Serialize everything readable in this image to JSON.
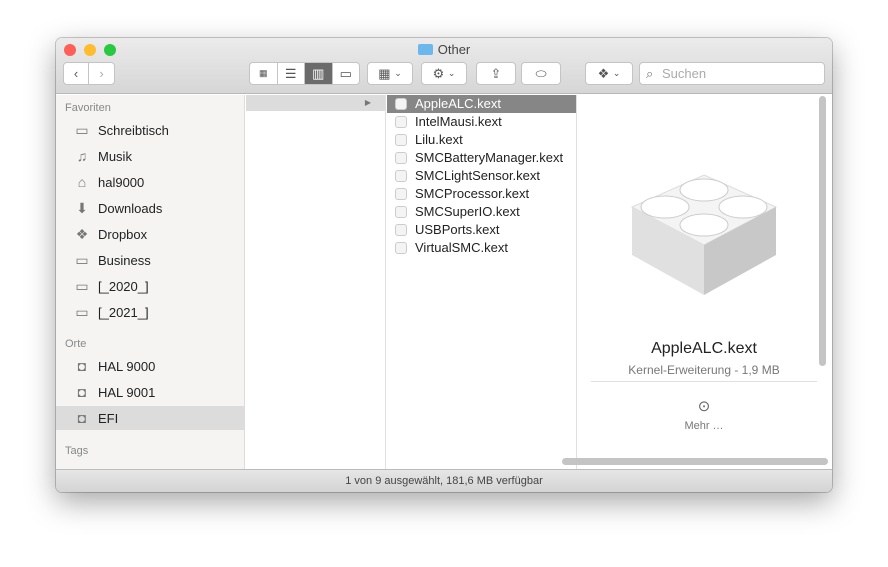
{
  "window": {
    "title": "Other"
  },
  "toolbar": {
    "search_placeholder": "Suchen"
  },
  "sidebar": {
    "favorites_header": "Favoriten",
    "favorites": [
      {
        "label": "Schreibtisch",
        "icon": "desktop-icon"
      },
      {
        "label": "Musik",
        "icon": "music-icon"
      },
      {
        "label": "hal9000",
        "icon": "home-icon"
      },
      {
        "label": "Downloads",
        "icon": "downloads-icon"
      },
      {
        "label": "Dropbox",
        "icon": "dropbox-icon"
      },
      {
        "label": "Business",
        "icon": "folder-icon"
      },
      {
        "label": "[_2020_]",
        "icon": "folder-icon"
      },
      {
        "label": "[_2021_]",
        "icon": "folder-icon"
      }
    ],
    "places_header": "Orte",
    "places": [
      {
        "label": "HAL 9000",
        "icon": "disk-icon"
      },
      {
        "label": "HAL 9001",
        "icon": "disk-icon"
      },
      {
        "label": "EFI",
        "icon": "disk-icon",
        "selected": true
      }
    ],
    "tags_header": "Tags"
  },
  "files": [
    "AppleALC.kext",
    "IntelMausi.kext",
    "Lilu.kext",
    "SMCBatteryManager.kext",
    "SMCLightSensor.kext",
    "SMCProcessor.kext",
    "SMCSuperIO.kext",
    "USBPorts.kext",
    "VirtualSMC.kext"
  ],
  "preview": {
    "name": "AppleALC.kext",
    "info": "Kernel-Erweiterung - 1,9 MB",
    "more": "Mehr …"
  },
  "status": "1 von 9 ausgewählt, 181,6 MB verfügbar"
}
